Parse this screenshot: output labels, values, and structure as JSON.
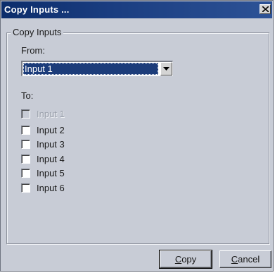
{
  "dialog": {
    "title": "Copy Inputs ...",
    "close_icon": "close-icon"
  },
  "group": {
    "legend": "Copy Inputs"
  },
  "from": {
    "label": "From:",
    "selected": "Input 1"
  },
  "to": {
    "label": "To:",
    "items": [
      {
        "label": "Input 1",
        "checked": false,
        "disabled": true
      },
      {
        "label": "Input 2",
        "checked": false,
        "disabled": false
      },
      {
        "label": "Input 3",
        "checked": false,
        "disabled": false
      },
      {
        "label": "Input 4",
        "checked": false,
        "disabled": false
      },
      {
        "label": "Input 5",
        "checked": false,
        "disabled": false
      },
      {
        "label": "Input 6",
        "checked": false,
        "disabled": false
      }
    ]
  },
  "buttons": {
    "copy_mnemonic": "C",
    "copy_rest": "opy",
    "cancel_mnemonic": "C",
    "cancel_rest": "ancel"
  },
  "colors": {
    "titlebar": "#0c2d6b",
    "dialog_bg": "#c8ccd6",
    "selection": "#1c3c7a"
  }
}
